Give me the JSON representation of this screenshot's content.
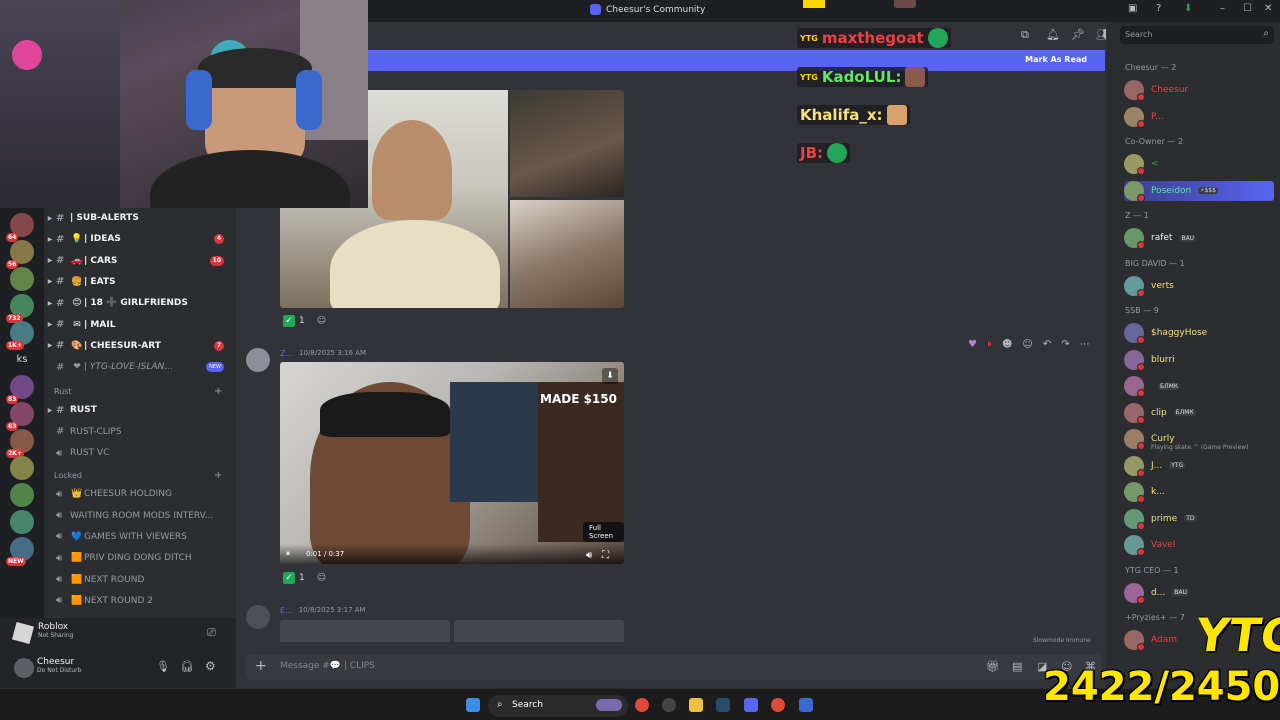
{
  "window": {
    "title": "Cheesur's Community"
  },
  "servers": [
    {
      "badge": "64"
    },
    {
      "badge": "56"
    },
    {
      "badge": ""
    },
    {
      "badge": "732"
    },
    {
      "badge": "1K+"
    },
    {
      "label": "ks"
    },
    {
      "badge": "83"
    },
    {
      "badge": "63"
    },
    {
      "badge": "2K+"
    },
    {
      "badge": ""
    },
    {
      "badge": ""
    },
    {
      "badge": ""
    },
    {
      "badge": "NEW"
    }
  ],
  "channels": {
    "top": [
      {
        "name": "| SUB-ALERTS",
        "emoji": "",
        "count": ""
      },
      {
        "name": "| IDEAS",
        "emoji": "💡",
        "count": "4"
      },
      {
        "name": "| CARS",
        "emoji": "🚗",
        "count": "10"
      },
      {
        "name": "| EATS",
        "emoji": "🍔",
        "count": ""
      },
      {
        "name": "| 18 ➕ GIRLFRIENDS",
        "emoji": "😊",
        "count": ""
      },
      {
        "name": "| MAIL",
        "emoji": "✉",
        "count": ""
      },
      {
        "name": "| CHEESUR-ART",
        "emoji": "🎨",
        "count": "7"
      },
      {
        "name": "| YTG-LOVE-ISLAN...",
        "emoji": "❤",
        "count": "",
        "new": "NEW"
      }
    ],
    "rust_category": "Rust",
    "rust": [
      "RUST",
      "RUST-CLIPS",
      "RUST VC"
    ],
    "locked_category": "Locked",
    "locked": [
      {
        "name": "CHEESUR HOLDING",
        "emoji": "👑"
      },
      {
        "name": "WAITING ROOM MODS INTERV...",
        "emoji": ""
      },
      {
        "name": "GAMES WITH VIEWERS",
        "emoji": "💙"
      },
      {
        "name": "PRIV DING DONG DITCH",
        "emoji": "🟧"
      },
      {
        "name": "NEXT ROUND",
        "emoji": "🟧"
      },
      {
        "name": "NEXT ROUND 2",
        "emoji": "🟧"
      }
    ]
  },
  "activity": {
    "name": "Roblox",
    "status": "Not Sharing"
  },
  "user": {
    "name": "Cheesur",
    "status": "Do Not Disturb"
  },
  "banner": {
    "mark_read": "Mark As Read"
  },
  "messages": [
    {
      "author": "Z...",
      "time": "10/8/2025 3:16 AM",
      "reaction_count": "1"
    },
    {
      "author": "E...",
      "time": "10/8/2025 3:17 AM"
    }
  ],
  "first_reaction_count": "1",
  "video": {
    "overlay_text": "MADE $150",
    "time": "0:01 / 0:37",
    "tooltip": "Full Screen"
  },
  "composer": {
    "placeholder": "Message #💬 | CLIPS",
    "slowmode": "Slowmode Immune"
  },
  "search": {
    "placeholder": "Search"
  },
  "member_groups": [
    {
      "label": "Cheesur — 2",
      "members": [
        {
          "name": "Cheesur",
          "color": "#f23f43"
        },
        {
          "name": "P...",
          "color": "#f23f43"
        }
      ]
    },
    {
      "label": "Co-Owner — 2",
      "members": [
        {
          "name": "<",
          "color": "#23a55a"
        },
        {
          "name": "Poseidon",
          "color": "#5ee6a0",
          "tag": "⚡$$$"
        }
      ]
    },
    {
      "label": "Z — 1",
      "members": [
        {
          "name": "rafet",
          "color": "#f2f3f5",
          "tag": "BAU"
        }
      ]
    },
    {
      "label": "BIG DAVID — 1",
      "members": [
        {
          "name": "verts",
          "color": "#f5e27a"
        }
      ]
    },
    {
      "label": "SSB — 9",
      "members": [
        {
          "name": "$haggyHose",
          "color": "#f5e27a"
        },
        {
          "name": "blurri",
          "color": "#f5e27a"
        },
        {
          "name": "",
          "color": "#f5e27a",
          "tag": "БЛМК"
        },
        {
          "name": "clip",
          "color": "#f5e27a",
          "tag": "БЛМК"
        },
        {
          "name": "Curly",
          "color": "#f5e27a",
          "sub": "Playing skate.™ (Game Preview)"
        },
        {
          "name": "J...",
          "color": "#f5e27a",
          "tag": "YTG"
        },
        {
          "name": "k...",
          "color": "#f5e27a"
        },
        {
          "name": "prime",
          "color": "#f5e27a",
          "tag": "TD"
        },
        {
          "name": "Vavel",
          "color": "#f23f43"
        }
      ]
    },
    {
      "label": "YTG CEO — 1",
      "members": [
        {
          "name": "d...",
          "color": "#f5e27a",
          "tag": "BAU"
        }
      ]
    },
    {
      "label": "+Pryzies+ — 7",
      "members": [
        {
          "name": "Adam",
          "color": "#f23f43"
        }
      ]
    }
  ],
  "stream_chat": [
    {
      "name": "maxthegoat",
      "color": "#f23f43"
    },
    {
      "name": "KadoLUL:",
      "color": "#5ee66a"
    },
    {
      "name": "Khalifa_x:",
      "color": "#f5e27a"
    },
    {
      "name": "JB:",
      "color": "#f23f43"
    }
  ],
  "taskbar": {
    "search": "Search"
  },
  "overlay": {
    "brand": "YTG",
    "goal": "2422/2450"
  },
  "colors": {
    "accent": "#5865f2",
    "dnd": "#da373c",
    "online": "#23a55a",
    "goal": "#ffe600"
  }
}
